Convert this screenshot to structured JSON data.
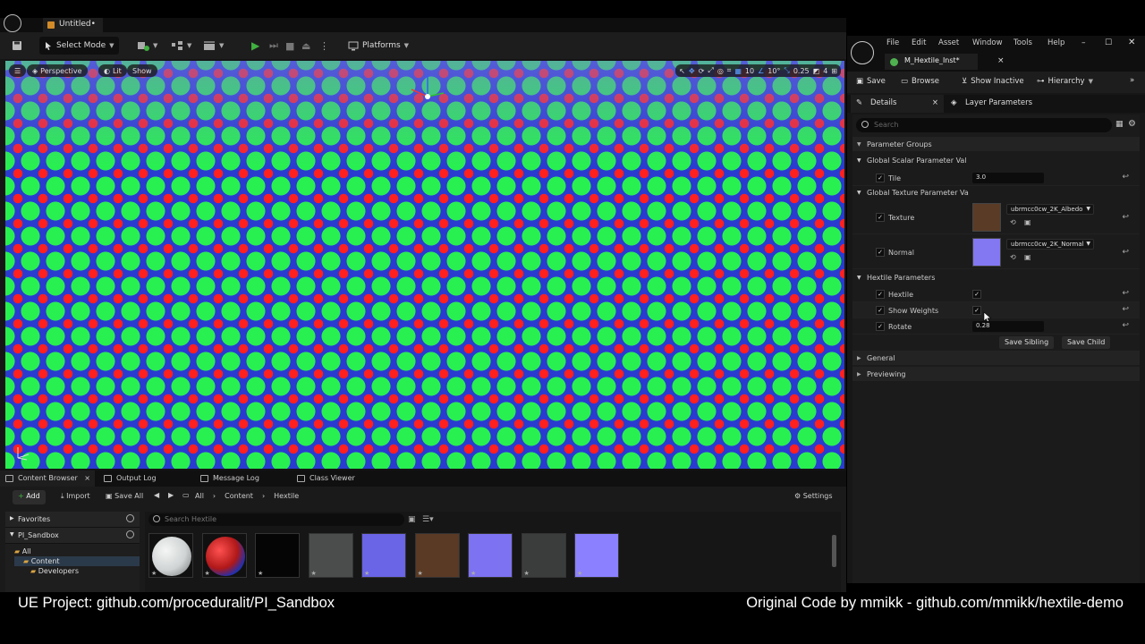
{
  "editor": {
    "doc_tab": "Untitled•",
    "toolbar": {
      "select_mode": "Select Mode",
      "platforms": "Platforms"
    },
    "viewport": {
      "perspective": "Perspective",
      "lit": "Lit",
      "show": "Show",
      "grid_size": "10",
      "rotation_snap": "10°",
      "scale_snap": "0.25",
      "camera_speed": "4"
    }
  },
  "bottom_panel": {
    "tabs": [
      "Content Browser",
      "Output Log",
      "Message Log",
      "Class Viewer"
    ],
    "add_label": "Add",
    "import_label": "Import",
    "save_all_label": "Save All",
    "breadcrumb": [
      "All",
      "Content",
      "Hextile"
    ],
    "settings_label": "Settings",
    "favorites_label": "Favorites",
    "project_label": "PI_Sandbox",
    "tree": [
      "All",
      "Content",
      "Developers"
    ],
    "search_placeholder": "Search Hextile",
    "tiles": [
      {
        "icon": "sphere-white-thumbnail",
        "color": "#cfd3d3"
      },
      {
        "icon": "hextile-sphere-thumbnail",
        "color": "#e33a3a"
      },
      {
        "icon": "black-texture-thumbnail",
        "color": "#050505"
      },
      {
        "icon": "gray-rough-texture-thumbnail",
        "color": "#4a4d4c"
      },
      {
        "icon": "blue-normal-texture-thumbnail",
        "color": "#6a64e6"
      },
      {
        "icon": "brown-albedo-texture-thumbnail",
        "color": "#5a3a24"
      },
      {
        "icon": "blue-normal-texture-thumbnail",
        "color": "#7d72f2"
      },
      {
        "icon": "gray-texture-thumbnail",
        "color": "#3b3d3c"
      },
      {
        "icon": "blue-normal-texture-thumbnail",
        "color": "#8b80ff"
      }
    ]
  },
  "material_editor": {
    "menus": [
      "File",
      "Edit",
      "Asset",
      "Window",
      "Tools",
      "Help"
    ],
    "tab": "M_Hextile_Inst*",
    "toolbar": {
      "save": "Save",
      "browse": "Browse",
      "show_inactive": "Show Inactive",
      "hierarchy": "Hierarchy"
    },
    "panel_tabs": {
      "details": "Details",
      "layer_parameters": "Layer Parameters"
    },
    "search_placeholder": "Search",
    "parameter_groups_label": "Parameter Groups",
    "scalar_group": "Global Scalar Parameter Val",
    "tile_label": "Tile",
    "tile_value": "3.0",
    "texture_group": "Global Texture Parameter Va",
    "texture_label": "Texture",
    "texture_asset": "ubrmcc0cw_2K_Albedo",
    "normal_label": "Normal",
    "normal_asset": "ubrmcc0cw_2K_Normal",
    "hextile_group": "Hextile Parameters",
    "hextile_label": "Hextile",
    "show_weights_label": "Show Weights",
    "rotate_label": "Rotate",
    "rotate_value": "0.28",
    "save_sibling": "Save Sibling",
    "save_child": "Save Child",
    "general_label": "General",
    "previewing_label": "Previewing"
  },
  "captions": {
    "left": "UE Project: github.com/proceduralit/PI_Sandbox",
    "right": "Original Code by mmikk - github.com/mmikk/hextile-demo"
  },
  "colors": {
    "hex_red": "#ff2020",
    "hex_green": "#28f050",
    "hex_blue": "#2a3bd0",
    "play_green": "#3fb13f"
  }
}
